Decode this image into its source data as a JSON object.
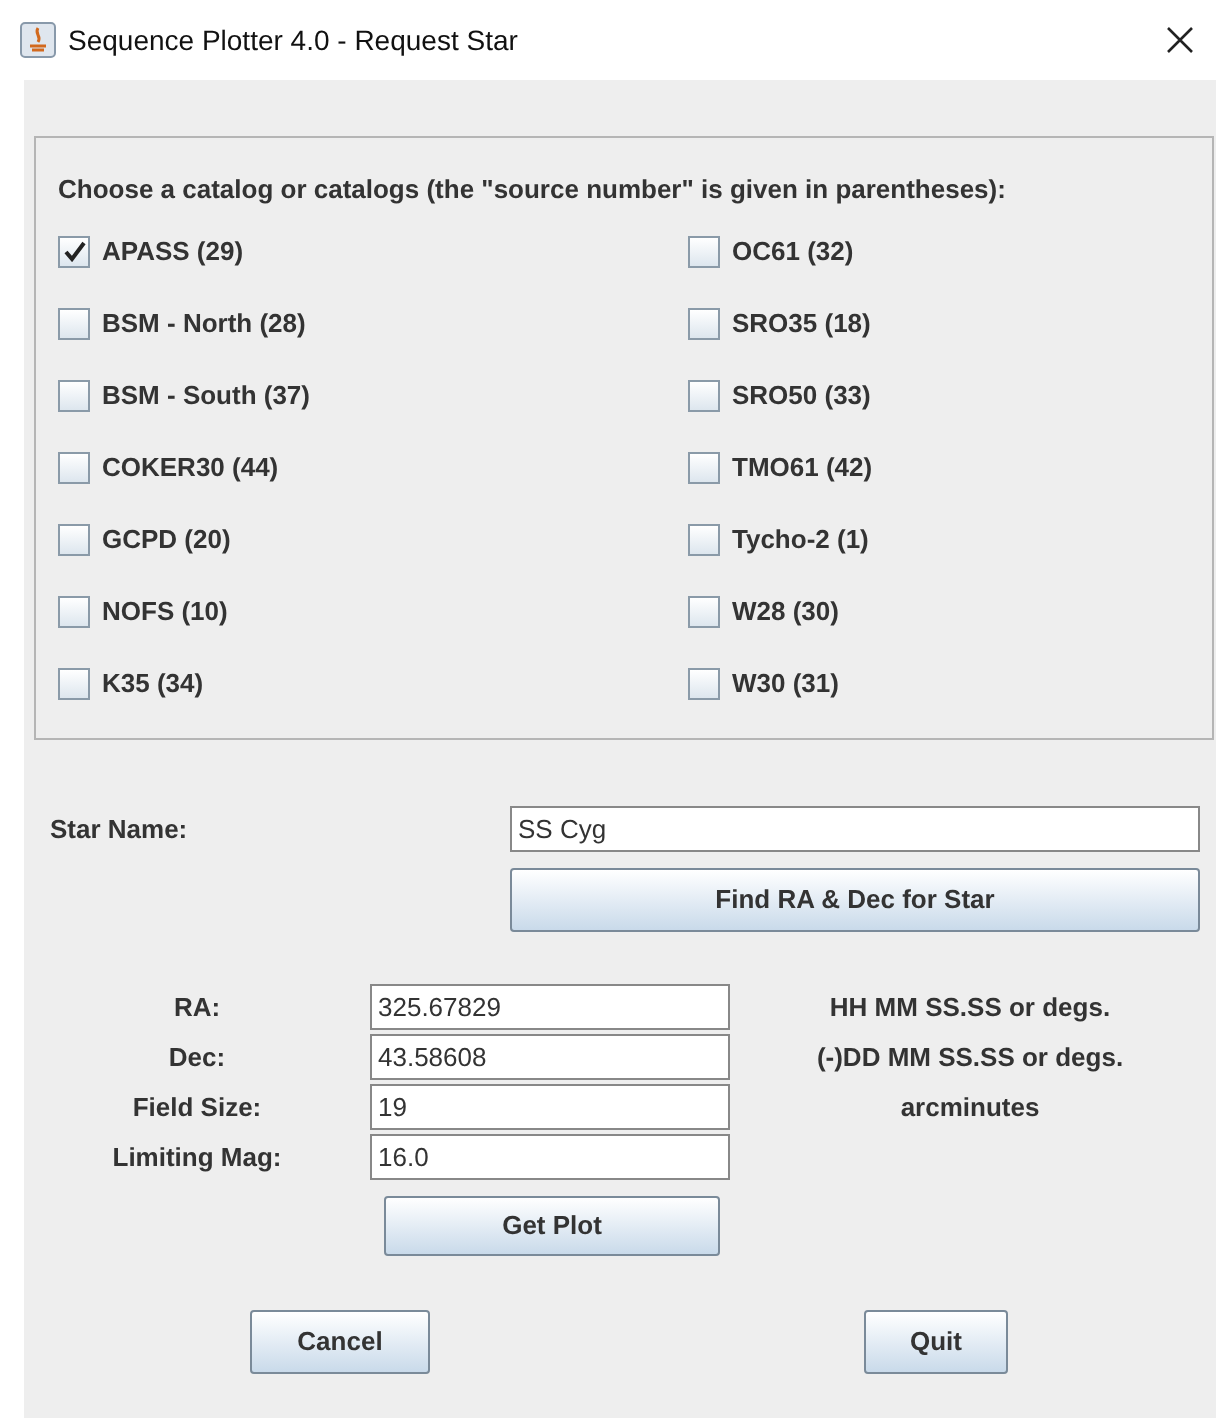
{
  "window": {
    "title": "Sequence Plotter 4.0 - Request Star"
  },
  "catalog_panel": {
    "heading": "Choose a catalog or catalogs (the \"source number\" is given in parentheses):",
    "left_column": [
      {
        "label": "APASS (29)",
        "checked": true
      },
      {
        "label": "BSM - North (28)",
        "checked": false
      },
      {
        "label": "BSM - South (37)",
        "checked": false
      },
      {
        "label": "COKER30 (44)",
        "checked": false
      },
      {
        "label": "GCPD (20)",
        "checked": false
      },
      {
        "label": "NOFS (10)",
        "checked": false
      },
      {
        "label": "K35 (34)",
        "checked": false
      }
    ],
    "right_column": [
      {
        "label": "OC61 (32)",
        "checked": false
      },
      {
        "label": "SRO35 (18)",
        "checked": false
      },
      {
        "label": "SRO50 (33)",
        "checked": false
      },
      {
        "label": "TMO61 (42)",
        "checked": false
      },
      {
        "label": "Tycho-2 (1)",
        "checked": false
      },
      {
        "label": "W28 (30)",
        "checked": false
      },
      {
        "label": "W30 (31)",
        "checked": false
      }
    ]
  },
  "star_name": {
    "label": "Star Name:",
    "value": "SS Cyg"
  },
  "find_button": "Find RA & Dec for Star",
  "parameters": [
    {
      "label": "RA:",
      "value": "325.67829",
      "hint": "HH MM SS.SS or degs."
    },
    {
      "label": "Dec:",
      "value": "43.58608",
      "hint": "(-)DD MM SS.SS or degs."
    },
    {
      "label": "Field Size:",
      "value": "19",
      "hint": "arcminutes"
    },
    {
      "label": "Limiting Mag:",
      "value": "16.0"
    }
  ],
  "get_plot_button": "Get Plot",
  "buttons": [
    "Cancel",
    "Quit"
  ]
}
